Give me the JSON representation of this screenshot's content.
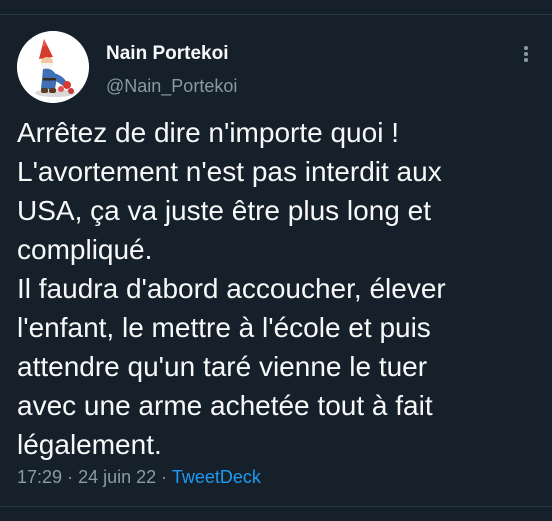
{
  "tweet": {
    "author": {
      "name": "Nain Portekoi",
      "handle": "@Nain_Portekoi",
      "avatar_icon": "garden-gnome-avatar"
    },
    "more_icon": "vertical-ellipsis-icon",
    "text_lines": [
      "Arrêtez de dire n'importe quoi !",
      "L'avortement n'est pas interdit aux",
      "USA, ça va juste être plus long et",
      "compliqué.",
      "Il faudra d'abord accoucher, élever",
      "l'enfant, le mettre à l'école et puis",
      "attendre qu'un taré vienne le tuer",
      "avec une arme achetée tout à fait",
      "légalement."
    ],
    "meta": {
      "time": "17:29",
      "separator": "·",
      "date": "24 juin 22",
      "source": "TweetDeck"
    }
  },
  "colors": {
    "background": "#15202b",
    "text": "#f7f9f9",
    "secondary": "#8b98a5",
    "link": "#1d9bf0",
    "divider": "#2a3641"
  }
}
